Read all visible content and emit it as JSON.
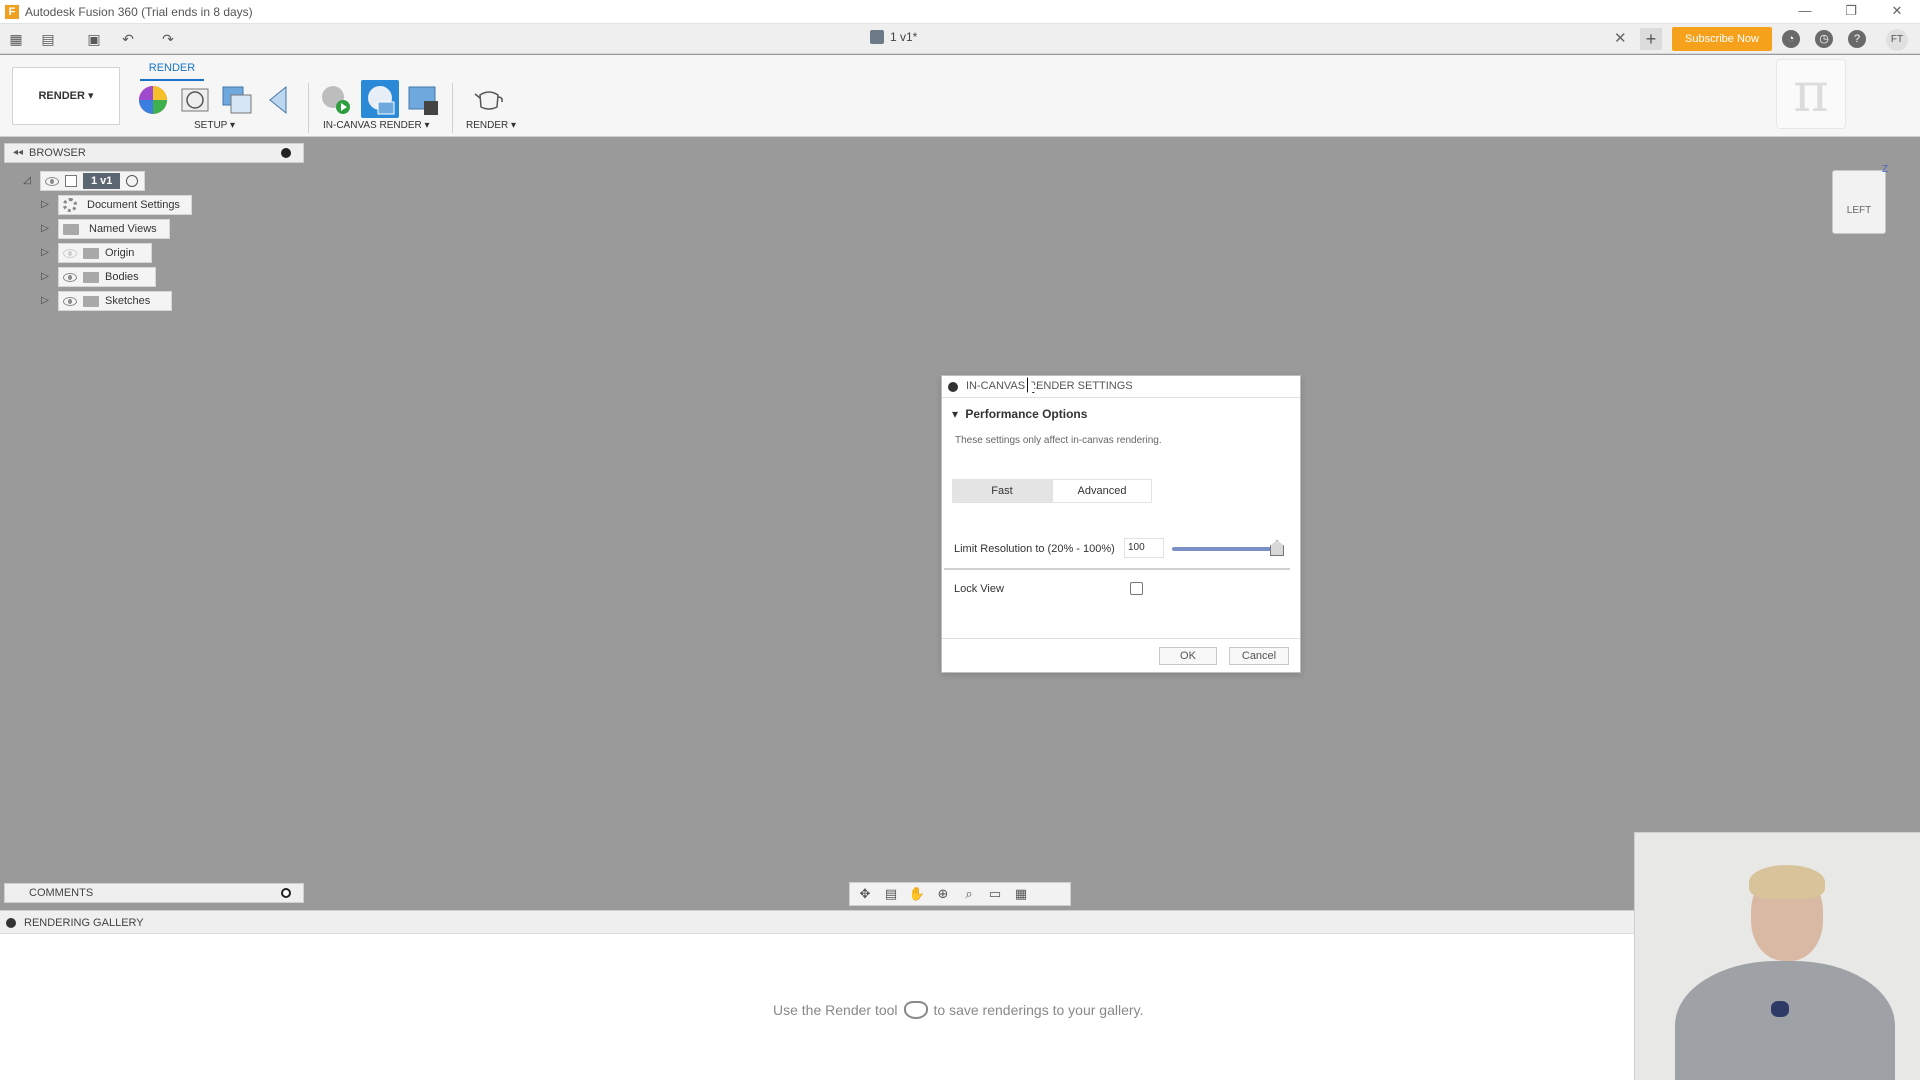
{
  "window": {
    "title": "Autodesk Fusion 360 (Trial ends in 8 days)",
    "app_logo": "F",
    "controls": [
      "—",
      "❐",
      "✕"
    ]
  },
  "tabbar": {
    "doc_title": "1 v1*",
    "close_glyph": "✕",
    "plus_glyph": "+",
    "subscribe_label": "Subscribe Now",
    "user_initials": "FT"
  },
  "ribbon": {
    "workspace_label": "RENDER ▾",
    "active_tab": "RENDER",
    "groups": {
      "setup": "SETUP ▾",
      "in_canvas": "IN-CANVAS RENDER ▾",
      "render": "RENDER ▾"
    },
    "logo_glyph": "π"
  },
  "browser": {
    "title": "BROWSER",
    "root_label": "1 v1",
    "items": [
      {
        "label": "Document Settings",
        "icon": "gear-icon"
      },
      {
        "label": "Named Views",
        "icon": "folder-icon"
      },
      {
        "label": "Origin",
        "icon": "folder-icon"
      },
      {
        "label": "Bodies",
        "icon": "folder-icon"
      },
      {
        "label": "Sketches",
        "icon": "folder-icon"
      }
    ]
  },
  "comments": {
    "title": "COMMENTS"
  },
  "viewcube": {
    "face": "LEFT",
    "axis": "Z"
  },
  "dialog": {
    "title": "IN-CANVAS RENDER SETTINGS",
    "section": "Performance Options",
    "note": "These settings only affect in-canvas rendering.",
    "modes": [
      "Fast",
      "Advanced"
    ],
    "selected_mode": "Fast",
    "resolution_label": "Limit Resolution to (20% - 100%)",
    "resolution_value": "100",
    "slider_percent": 100,
    "lock_view_label": "Lock View",
    "lock_view_checked": false,
    "ok_label": "OK",
    "cancel_label": "Cancel"
  },
  "gallery": {
    "title": "RENDERING GALLERY",
    "message_before": "Use the Render tool",
    "message_after": "to save renderings to your gallery."
  },
  "colors": {
    "accent": "#1a73c8",
    "subscribe": "#f5a11c",
    "canvas": "#9a9a9a"
  }
}
